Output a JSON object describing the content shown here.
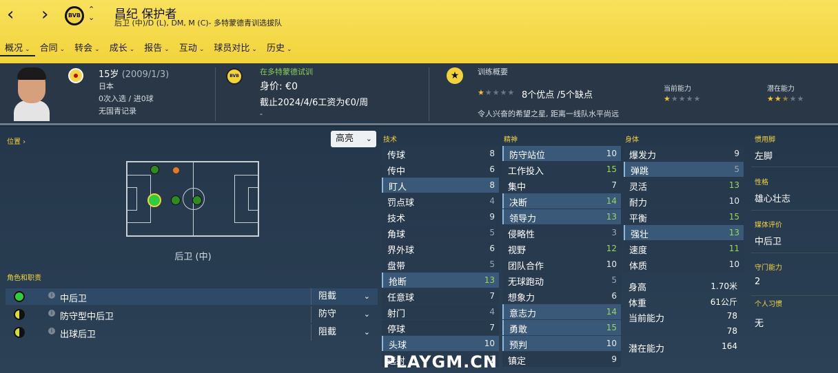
{
  "header": {
    "back_icon": "‹",
    "forward_icon": "›",
    "club_badge_text": "BVB",
    "player_name": "昌纪 保护者",
    "player_subtitle": "后卫 (中)/D (L), DM, M (C)- 多特蒙德青训选拔队",
    "tabs": [
      {
        "label": "概况"
      },
      {
        "label": "合同"
      },
      {
        "label": "转会"
      },
      {
        "label": "成长"
      },
      {
        "label": "报告"
      },
      {
        "label": "互动"
      },
      {
        "label": "球员对比"
      },
      {
        "label": "历史"
      }
    ]
  },
  "overview": {
    "age": "15岁",
    "dob": "(2009/1/3)",
    "nationality": "日本",
    "caps": "0次入选 / 进0球",
    "youth_record": "无国青记录",
    "trial_status": "在多特蒙德试训",
    "value": "身价: €0",
    "contract": "截止2024/4/6工资为€0/周",
    "contract_extra": "-",
    "training_title": "训练概要",
    "training_summary": "8个优点 /5个缺点",
    "training_rating": 1,
    "current_ability_label": "当前能力",
    "current_ability_stars": 1,
    "potential_ability_label": "潜在能力",
    "potential_ability_stars": 2.5,
    "training_desc": "令人兴奋的希望之星, 距离一线队水平尚远"
  },
  "position": {
    "title": "位置 ›",
    "highlight_label": "高亮",
    "current_position": "后卫 (中)"
  },
  "roles": {
    "title": "角色和职责",
    "items": [
      {
        "name": "中后卫",
        "duty": "阻截"
      },
      {
        "name": "防守型中后卫",
        "duty": "防守"
      },
      {
        "name": "出球后卫",
        "duty": "阻截"
      }
    ]
  },
  "technical": {
    "title": "技术",
    "items": [
      {
        "name": "传球",
        "value": "8"
      },
      {
        "name": "传中",
        "value": "6"
      },
      {
        "name": "盯人",
        "value": "8"
      },
      {
        "name": "罚点球",
        "value": "4"
      },
      {
        "name": "技术",
        "value": "9"
      },
      {
        "name": "角球",
        "value": "5"
      },
      {
        "name": "界外球",
        "value": "6"
      },
      {
        "name": "盘带",
        "value": "5"
      },
      {
        "name": "抢断",
        "value": "13"
      },
      {
        "name": "任意球",
        "value": "7"
      },
      {
        "name": "射门",
        "value": "4"
      },
      {
        "name": "停球",
        "value": "7"
      },
      {
        "name": "头球",
        "value": "10"
      },
      {
        "name": "远射",
        "value": "7"
      }
    ]
  },
  "mental": {
    "title": "精神",
    "items": [
      {
        "name": "防守站位",
        "value": "10"
      },
      {
        "name": "工作投入",
        "value": "15"
      },
      {
        "name": "集中",
        "value": "7"
      },
      {
        "name": "决断",
        "value": "14"
      },
      {
        "name": "领导力",
        "value": "13"
      },
      {
        "name": "侵略性",
        "value": "3"
      },
      {
        "name": "视野",
        "value": "12"
      },
      {
        "name": "团队合作",
        "value": "10"
      },
      {
        "name": "无球跑动",
        "value": "5"
      },
      {
        "name": "想象力",
        "value": "6"
      },
      {
        "name": "意志力",
        "value": "14"
      },
      {
        "name": "勇敢",
        "value": "15"
      },
      {
        "name": "预判",
        "value": "10"
      },
      {
        "name": "镇定",
        "value": "9"
      }
    ]
  },
  "physical": {
    "title": "身体",
    "items": [
      {
        "name": "爆发力",
        "value": "9"
      },
      {
        "name": "弹跳",
        "value": "5"
      },
      {
        "name": "灵活",
        "value": "13"
      },
      {
        "name": "耐力",
        "value": "10"
      },
      {
        "name": "平衡",
        "value": "15"
      },
      {
        "name": "强壮",
        "value": "13"
      },
      {
        "name": "速度",
        "value": "11"
      },
      {
        "name": "体质",
        "value": "10"
      }
    ],
    "info": [
      {
        "name": "身高",
        "value": "1.70米"
      },
      {
        "name": "体重",
        "value": "61公斤"
      },
      {
        "name": "当前能力",
        "value": "78"
      },
      {
        "name": "",
        "value": "78"
      },
      {
        "name": "潜在能力",
        "value": "164"
      }
    ]
  },
  "side": {
    "foot_label": "惯用脚",
    "foot_value": "左脚",
    "personality_label": "性格",
    "personality_value": "雄心壮志",
    "media_label": "媒体评价",
    "media_value": "中后卫",
    "gk_label": "守门能力",
    "gk_value": "2",
    "habits_label": "个人习惯",
    "habits_value": "无"
  },
  "watermark": "PLAYGM.CN",
  "colors": {
    "header_yellow": "#f2d33b",
    "accent_green": "#9bd65a",
    "label_yellow": "#f0d343",
    "natural_pos_green": "#2ecc40",
    "accomplished_green": "#2e8b1f",
    "unconvincing_orange": "#e87a1e"
  }
}
